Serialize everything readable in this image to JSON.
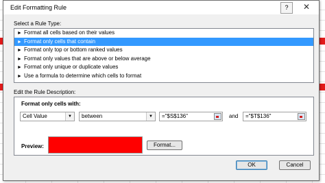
{
  "dialog": {
    "title": "Edit Formatting Rule",
    "help_label": "?",
    "close_label": "✕"
  },
  "rule_type": {
    "label": "Select a Rule Type:",
    "items": [
      "Format all cells based on their values",
      "Format only cells that contain",
      "Format only top or bottom ranked values",
      "Format only values that are above or below average",
      "Format only unique or duplicate values",
      "Use a formula to determine which cells to format"
    ],
    "selected_index": 1
  },
  "description": {
    "label": "Edit the Rule Description:",
    "format_label": "Format only cells with:",
    "condition_type": "Cell Value",
    "operator": "between",
    "value1": "=\"$S$136\"",
    "and_label": "and",
    "value2": "=\"$T$136\"",
    "preview_label": "Preview:",
    "preview_color": "#ff0000",
    "format_button": "Format..."
  },
  "footer": {
    "ok_label": "OK",
    "cancel_label": "Cancel"
  }
}
